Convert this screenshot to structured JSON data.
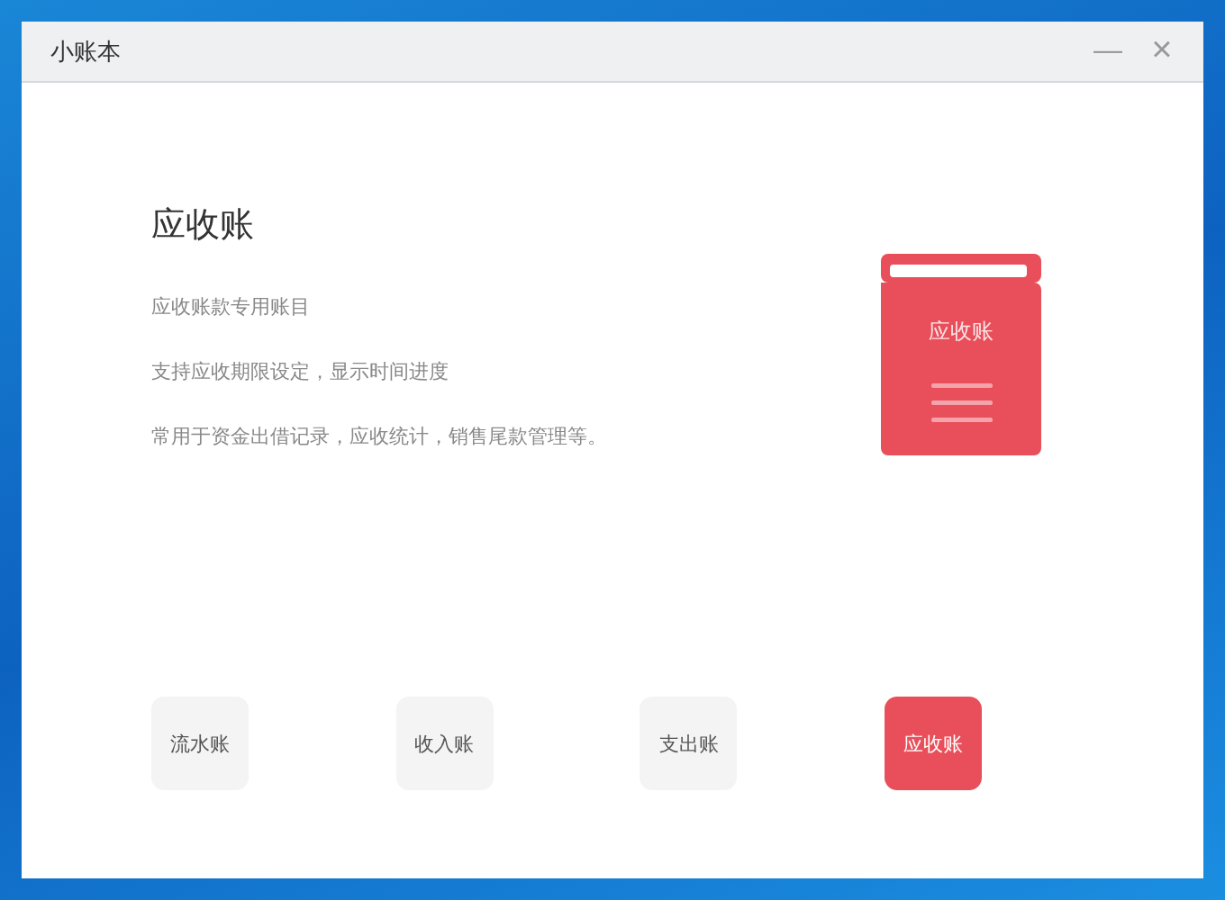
{
  "window": {
    "title": "小账本",
    "minimize": "—",
    "close": "×"
  },
  "detail": {
    "title": "应收账",
    "lines": [
      "应收账款专用账目",
      "支持应收期限设定，显示时间进度",
      "常用于资金出借记录，应收统计，销售尾款管理等。"
    ],
    "book_label": "应收账"
  },
  "tabs": [
    {
      "label": "流水账",
      "selected": false
    },
    {
      "label": "收入账",
      "selected": false
    },
    {
      "label": "支出账",
      "selected": false
    },
    {
      "label": "应收账",
      "selected": true
    }
  ]
}
